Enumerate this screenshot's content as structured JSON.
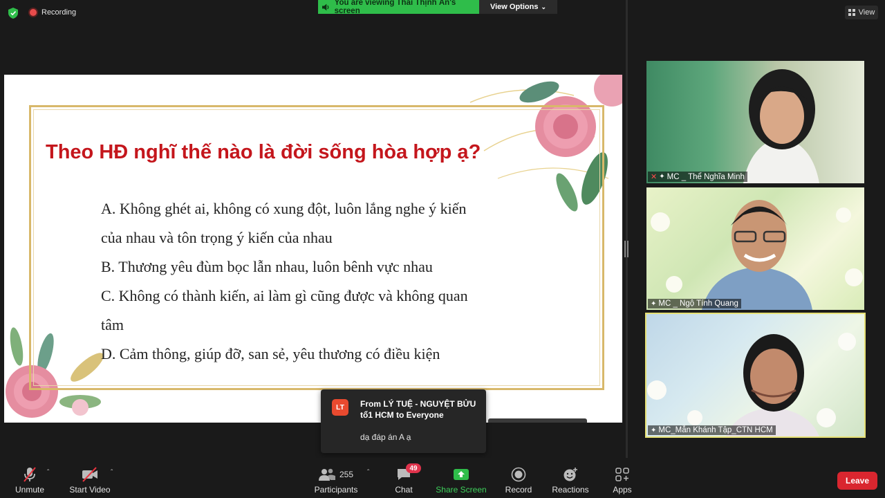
{
  "top_bar": {
    "recording_label": "Recording",
    "banner_text": "You are viewing Thái Thịnh Ấn's screen",
    "view_options_label": "View Options",
    "view_label": "View"
  },
  "slide": {
    "title": "Theo HĐ nghĩ thế nào là đời sống  hòa hợp ạ?",
    "lines": [
      "A. Không ghét ai, không có xung đột, luôn lắng nghe ý kiến",
      "của nhau và tôn trọng ý kiến của nhau",
      "B. Thương yêu đùm bọc lẫn nhau, luôn bênh vực nhau",
      "C. Không có thành kiến, ai làm gì cũng được và không quan",
      "tâm",
      "D. Cảm thông, giúp đỡ, san sẻ, yêu thương có điều kiện"
    ]
  },
  "participants": [
    {
      "name": "MC _ Thể Nghĩa Minh",
      "muted": true
    },
    {
      "name": "MC _ Ngộ Tính Quang",
      "muted": false
    },
    {
      "name": "MC_Mẫn Khánh Tập_CTN HCM",
      "muted": false,
      "active_speaker": true
    }
  ],
  "chat_notification": {
    "avatar_initials": "LT",
    "from": "From LÝ TUỆ - NGUYỆT BỬU tổ1 HCM to Everyone",
    "message": "dạ đáp án A ạ"
  },
  "toolbar": {
    "unmute_label": "Unmute",
    "start_video_label": "Start Video",
    "participants_label": "Participants",
    "participants_count": "255",
    "chat_label": "Chat",
    "chat_badge": "49",
    "share_screen_label": "Share Screen",
    "record_label": "Record",
    "reactions_label": "Reactions",
    "apps_label": "Apps",
    "leave_label": "Leave"
  },
  "colors": {
    "banner_green": "#2fbd4a",
    "slide_title_red": "#c4161c",
    "leave_red": "#d9262f",
    "share_green": "#3ed05b",
    "active_speaker_border": "#e6e074"
  }
}
